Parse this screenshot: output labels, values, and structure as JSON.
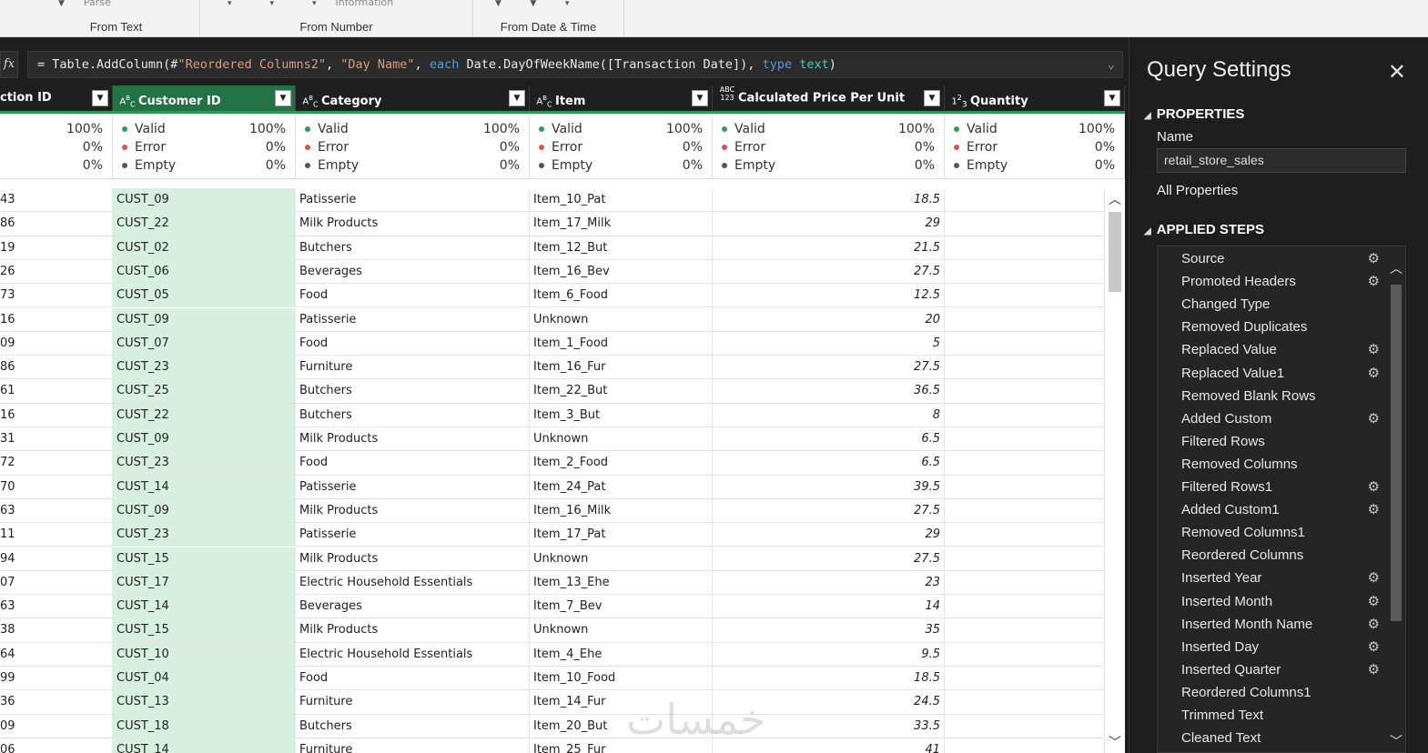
{
  "ribbon": {
    "groups": [
      {
        "label": "From Text",
        "stub": "Parse"
      },
      {
        "label": "From Number",
        "stub": "Information"
      },
      {
        "label": "From Date & Time",
        "stub": ""
      }
    ]
  },
  "formula_bar": {
    "fx_label": "fx",
    "parts": {
      "p1": "= Table.AddColumn(#",
      "s1": "\"Reordered Columns2\"",
      "p2": ", ",
      "s2": "\"Day Name\"",
      "p3": ", ",
      "k1": "each",
      "p4": " Date.DayOfWeekName([Transaction Date]), ",
      "k2": "type",
      "p5": " ",
      "t1": "text",
      "p6": ")"
    }
  },
  "columns": [
    {
      "title": "ction ID",
      "type_icon": "",
      "stats": {
        "valid": "100%",
        "error": "0%",
        "empty": "0%"
      }
    },
    {
      "title": "Customer ID",
      "type_icon": "ABC",
      "stats": {
        "valid": "100%",
        "error": "0%",
        "empty": "0%"
      }
    },
    {
      "title": "Category",
      "type_icon": "ABC",
      "stats": {
        "valid": "100%",
        "error": "0%",
        "empty": "0%"
      }
    },
    {
      "title": "Item",
      "type_icon": "ABC",
      "stats": {
        "valid": "100%",
        "error": "0%",
        "empty": "0%"
      }
    },
    {
      "title": "Calculated Price Per Unit",
      "type_icon": "ABC 123",
      "stats": {
        "valid": "100%",
        "error": "0%",
        "empty": "0%"
      }
    },
    {
      "title": "Quantity",
      "type_icon": "123",
      "stats": {
        "valid": "100%",
        "error": "0%",
        "empty": "0%"
      }
    }
  ],
  "stat_labels": {
    "valid": "Valid",
    "error": "Error",
    "empty": "Empty"
  },
  "rows": [
    [
      "43",
      "CUST_09",
      "Patisserie",
      "Item_10_Pat",
      "18.5",
      ""
    ],
    [
      "86",
      "CUST_22",
      "Milk Products",
      "Item_17_Milk",
      "29",
      ""
    ],
    [
      "19",
      "CUST_02",
      "Butchers",
      "Item_12_But",
      "21.5",
      ""
    ],
    [
      "26",
      "CUST_06",
      "Beverages",
      "Item_16_Bev",
      "27.5",
      ""
    ],
    [
      "73",
      "CUST_05",
      "Food",
      "Item_6_Food",
      "12.5",
      ""
    ],
    [
      "16",
      "CUST_09",
      "Patisserie",
      "Unknown",
      "20",
      ""
    ],
    [
      "09",
      "CUST_07",
      "Food",
      "Item_1_Food",
      "5",
      ""
    ],
    [
      "86",
      "CUST_23",
      "Furniture",
      "Item_16_Fur",
      "27.5",
      ""
    ],
    [
      "61",
      "CUST_25",
      "Butchers",
      "Item_22_But",
      "36.5",
      ""
    ],
    [
      "16",
      "CUST_22",
      "Butchers",
      "Item_3_But",
      "8",
      ""
    ],
    [
      "31",
      "CUST_09",
      "Milk Products",
      "Unknown",
      "6.5",
      ""
    ],
    [
      "72",
      "CUST_23",
      "Food",
      "Item_2_Food",
      "6.5",
      ""
    ],
    [
      "70",
      "CUST_14",
      "Patisserie",
      "Item_24_Pat",
      "39.5",
      ""
    ],
    [
      "63",
      "CUST_09",
      "Milk Products",
      "Item_16_Milk",
      "27.5",
      ""
    ],
    [
      "11",
      "CUST_23",
      "Patisserie",
      "Item_17_Pat",
      "29",
      ""
    ],
    [
      "94",
      "CUST_15",
      "Milk Products",
      "Unknown",
      "27.5",
      ""
    ],
    [
      "07",
      "CUST_17",
      "Electric Household Essentials",
      "Item_13_Ehe",
      "23",
      ""
    ],
    [
      "63",
      "CUST_14",
      "Beverages",
      "Item_7_Bev",
      "14",
      ""
    ],
    [
      "38",
      "CUST_15",
      "Milk Products",
      "Unknown",
      "35",
      ""
    ],
    [
      "64",
      "CUST_10",
      "Electric Household Essentials",
      "Item_4_Ehe",
      "9.5",
      ""
    ],
    [
      "99",
      "CUST_04",
      "Food",
      "Item_10_Food",
      "18.5",
      ""
    ],
    [
      "36",
      "CUST_13",
      "Furniture",
      "Item_14_Fur",
      "24.5",
      ""
    ],
    [
      "09",
      "CUST_18",
      "Butchers",
      "Item_20_But",
      "33.5",
      ""
    ],
    [
      "06",
      "CUST_14",
      "Furniture",
      "Item_25_Fur",
      "41",
      ""
    ]
  ],
  "query_settings": {
    "title": "Query Settings",
    "properties_label": "PROPERTIES",
    "name_label": "Name",
    "name_value": "retail_store_sales",
    "all_properties": "All Properties",
    "applied_steps_label": "APPLIED STEPS",
    "steps": [
      {
        "label": "Source",
        "gear": true
      },
      {
        "label": "Promoted Headers",
        "gear": true
      },
      {
        "label": "Changed Type",
        "gear": false
      },
      {
        "label": "Removed Duplicates",
        "gear": false
      },
      {
        "label": "Replaced Value",
        "gear": true
      },
      {
        "label": "Replaced Value1",
        "gear": true
      },
      {
        "label": "Removed Blank Rows",
        "gear": false
      },
      {
        "label": "Added Custom",
        "gear": true
      },
      {
        "label": "Filtered Rows",
        "gear": false
      },
      {
        "label": "Removed Columns",
        "gear": false
      },
      {
        "label": "Filtered Rows1",
        "gear": true
      },
      {
        "label": "Added Custom1",
        "gear": true
      },
      {
        "label": "Removed Columns1",
        "gear": false
      },
      {
        "label": "Reordered Columns",
        "gear": false
      },
      {
        "label": "Inserted Year",
        "gear": true
      },
      {
        "label": "Inserted Month",
        "gear": true
      },
      {
        "label": "Inserted Month Name",
        "gear": true
      },
      {
        "label": "Inserted Day",
        "gear": true
      },
      {
        "label": "Inserted Quarter",
        "gear": true
      },
      {
        "label": "Reordered Columns1",
        "gear": false
      },
      {
        "label": "Trimmed Text",
        "gear": false
      },
      {
        "label": "Cleaned Text",
        "gear": false
      }
    ]
  },
  "watermark": "خمسات",
  "icons": {
    "gear": "gear-icon",
    "close": "close-icon",
    "filter": "filter-dropdown-icon",
    "scroll-up": "chevron-up-icon",
    "scroll-down": "chevron-down-icon"
  }
}
